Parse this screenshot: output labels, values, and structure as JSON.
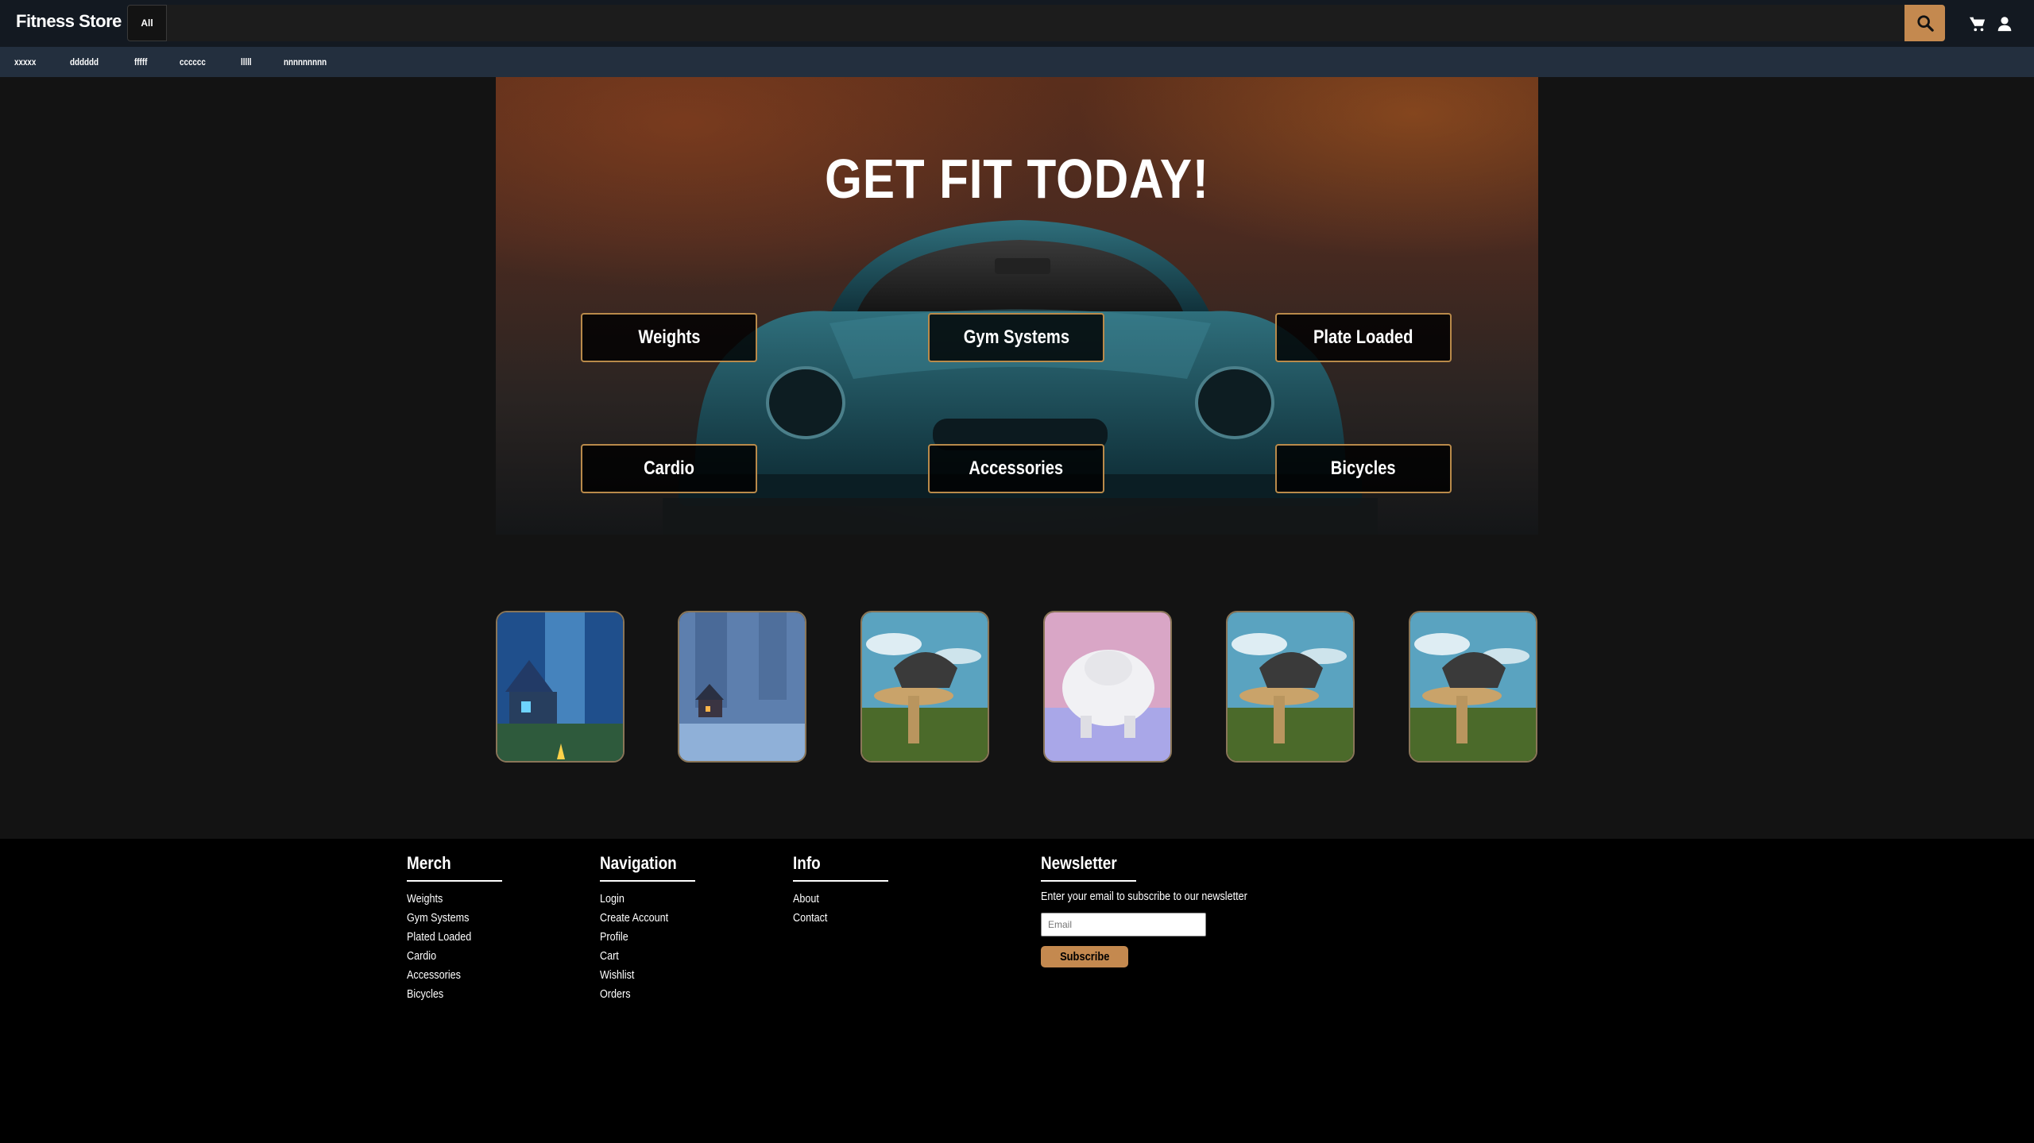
{
  "header": {
    "brand": "Fitness Store",
    "category_select": "All",
    "search_placeholder": "",
    "icons": [
      "search-icon",
      "cart-icon",
      "user-icon"
    ],
    "accent_color": "#c4894f"
  },
  "subnav": {
    "items": [
      "xxxxx",
      "dddddd",
      "fffff",
      "cccccc",
      "lllll",
      "nnnnnnnnn"
    ]
  },
  "hero": {
    "title": "GET FIT TODAY!",
    "buttons": [
      "Weights",
      "Gym Systems",
      "Plate Loaded",
      "Cardio",
      "Accessories",
      "Bicycles"
    ]
  },
  "thumbnails": {
    "count": 6,
    "subjects": [
      "fantasy-forest-cabin",
      "snowy-cabin",
      "mushroom-creature",
      "buffalo-creature",
      "mushroom-creature",
      "mushroom-creature"
    ]
  },
  "footer": {
    "merch": {
      "title": "Merch",
      "links": [
        "Weights",
        "Gym Systems",
        "Plated Loaded",
        "Cardio",
        "Accessories",
        "Bicycles"
      ]
    },
    "navigation": {
      "title": "Navigation",
      "links": [
        "Login",
        "Create Account",
        "Profile",
        "Cart",
        "Wishlist",
        "Orders"
      ]
    },
    "info": {
      "title": "Info",
      "links": [
        "About",
        "Contact"
      ]
    },
    "newsletter": {
      "title": "Newsletter",
      "description": "Enter your email to subscribe to our newsletter",
      "email_placeholder": "Email",
      "subscribe_label": "Subscribe"
    }
  }
}
